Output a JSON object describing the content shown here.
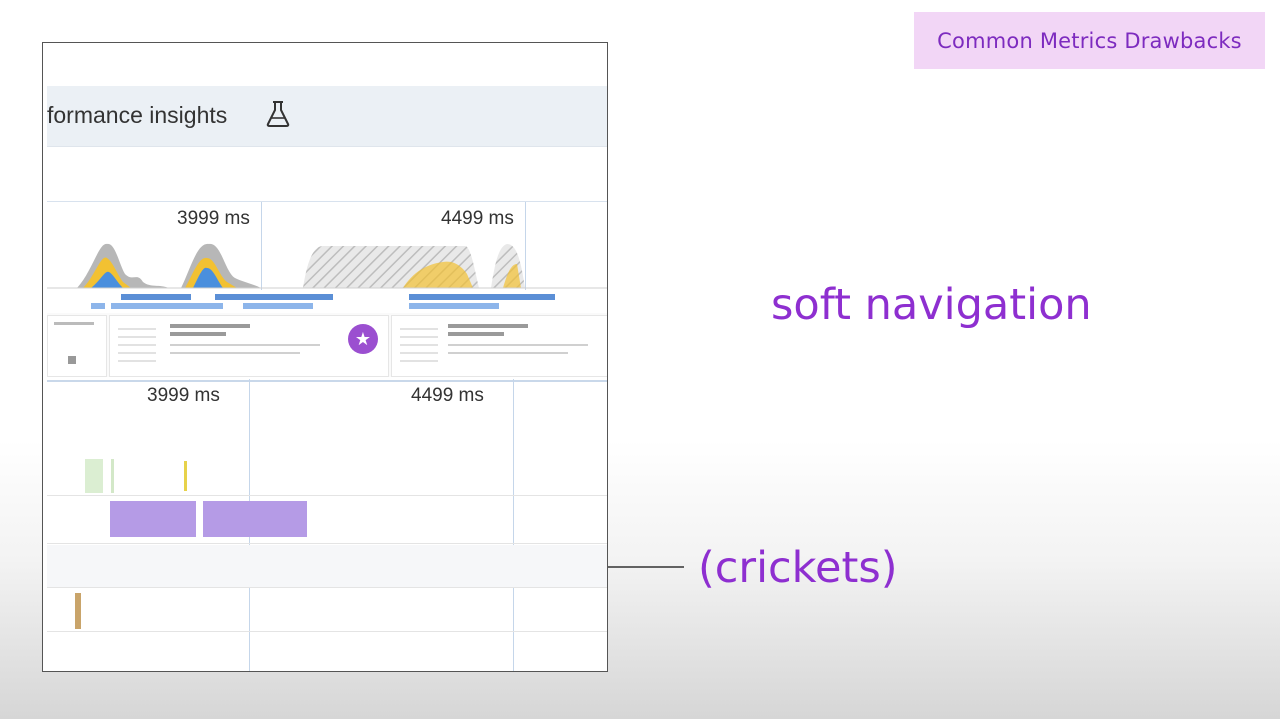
{
  "slide": {
    "badge": "Common Metrics Drawbacks",
    "heading": "soft navigation",
    "callout": "(crickets)"
  },
  "devtools": {
    "panel_title": "formance insights",
    "overview_times": [
      "3999 ms",
      "4499 ms"
    ],
    "timeline_times": [
      "3999 ms",
      "4499 ms"
    ]
  },
  "colors": {
    "accent_purple": "#8e2fd0",
    "badge_bg": "#f2d6f6",
    "cpu_yellow": "#f2c132",
    "cpu_blue": "#4a8fdd",
    "network_blue": "#5b8fd6",
    "task_purple": "#b59be6"
  },
  "icons": {
    "panel_icon": "flask-icon",
    "thumb_icon": "star-badge-icon",
    "callout_icon": "arrow-left-icon"
  }
}
